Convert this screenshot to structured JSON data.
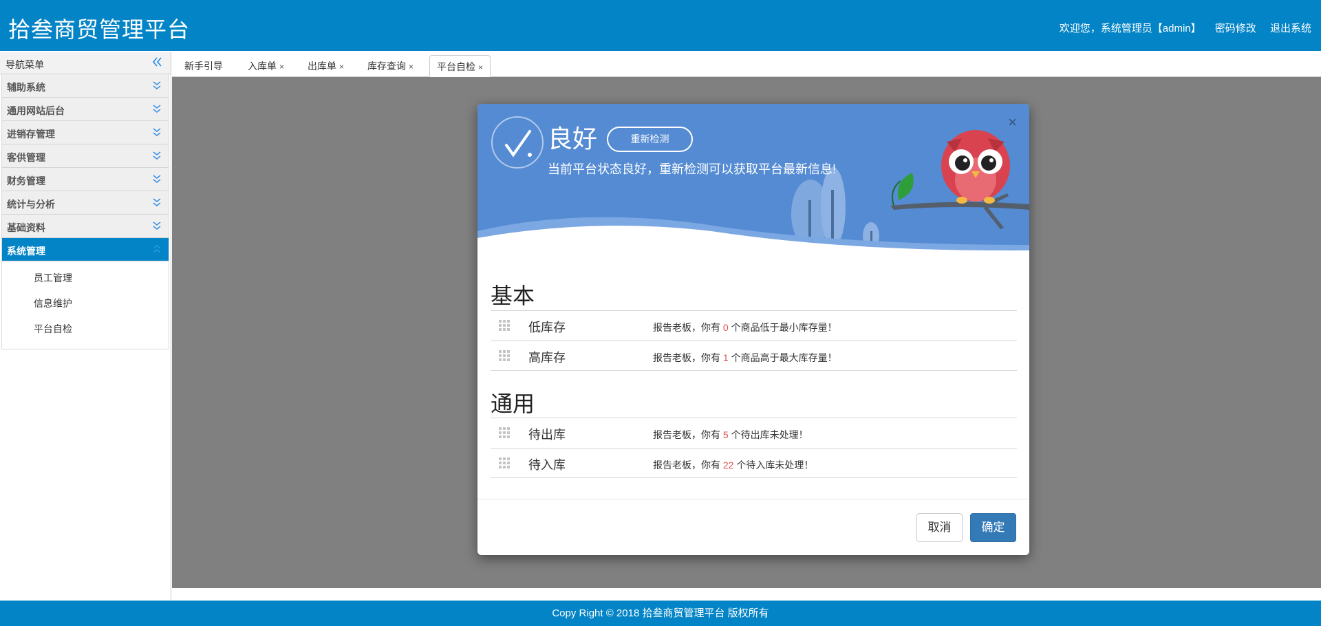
{
  "header": {
    "app_title": "拾叁商贸管理平台",
    "welcome": "欢迎您，系统管理员【admin】",
    "change_password": "密码修改",
    "logout": "退出系统"
  },
  "sidebar": {
    "title": "导航菜单",
    "groups": [
      {
        "label": "辅助系统",
        "expanded": false
      },
      {
        "label": "通用网站后台",
        "expanded": false
      },
      {
        "label": "进销存管理",
        "expanded": false
      },
      {
        "label": "客供管理",
        "expanded": false
      },
      {
        "label": "财务管理",
        "expanded": false
      },
      {
        "label": "统计与分析",
        "expanded": false
      },
      {
        "label": "基础资料",
        "expanded": false
      },
      {
        "label": "系统管理",
        "expanded": true
      }
    ],
    "sub_items": [
      "员工管理",
      "信息维护",
      "平台自检"
    ]
  },
  "tabs": [
    {
      "label": "新手引导",
      "closable": false
    },
    {
      "label": "入库单",
      "closable": true
    },
    {
      "label": "出库单",
      "closable": true
    },
    {
      "label": "库存查询",
      "closable": true
    },
    {
      "label": "平台自检",
      "closable": true,
      "selected": true
    }
  ],
  "tab_close_glyph": "×",
  "modal": {
    "status_word": "良好",
    "recheck_label": "重新检测",
    "status_desc": "当前平台状态良好，重新检测可以获取平台最新信息!",
    "close_glyph": "×",
    "sections": [
      {
        "title": "基本",
        "rows": [
          {
            "name": "低库存",
            "prefix": "报告老板，你有 ",
            "count": "0",
            "suffix": " 个商品低于最小库存量！"
          },
          {
            "name": "高库存",
            "prefix": "报告老板，你有 ",
            "count": "1",
            "suffix": " 个商品高于最大库存量！"
          }
        ]
      },
      {
        "title": "通用",
        "rows": [
          {
            "name": "待出库",
            "prefix": "报告老板，你有 ",
            "count": "5",
            "suffix": " 个待出库未处理！"
          },
          {
            "name": "待入库",
            "prefix": "报告老板，你有 ",
            "count": "22",
            "suffix": " 个待入库未处理！"
          }
        ]
      }
    ],
    "cancel_label": "取消",
    "ok_label": "确定"
  },
  "footer": {
    "copyright": "Copy Right © 2018 拾叁商贸管理平台 版权所有"
  },
  "colors": {
    "brand_blue": "#0384c6",
    "hero_blue": "#548bd3",
    "count_red": "#d9534f",
    "primary_button": "#337ab7"
  },
  "icons": {
    "collapse": "double-chevron-left-icon",
    "group": "double-chevron-down-icon",
    "status": "checkmark-circle-icon",
    "row": "grip-icon",
    "mascot": "owl-illustration"
  }
}
